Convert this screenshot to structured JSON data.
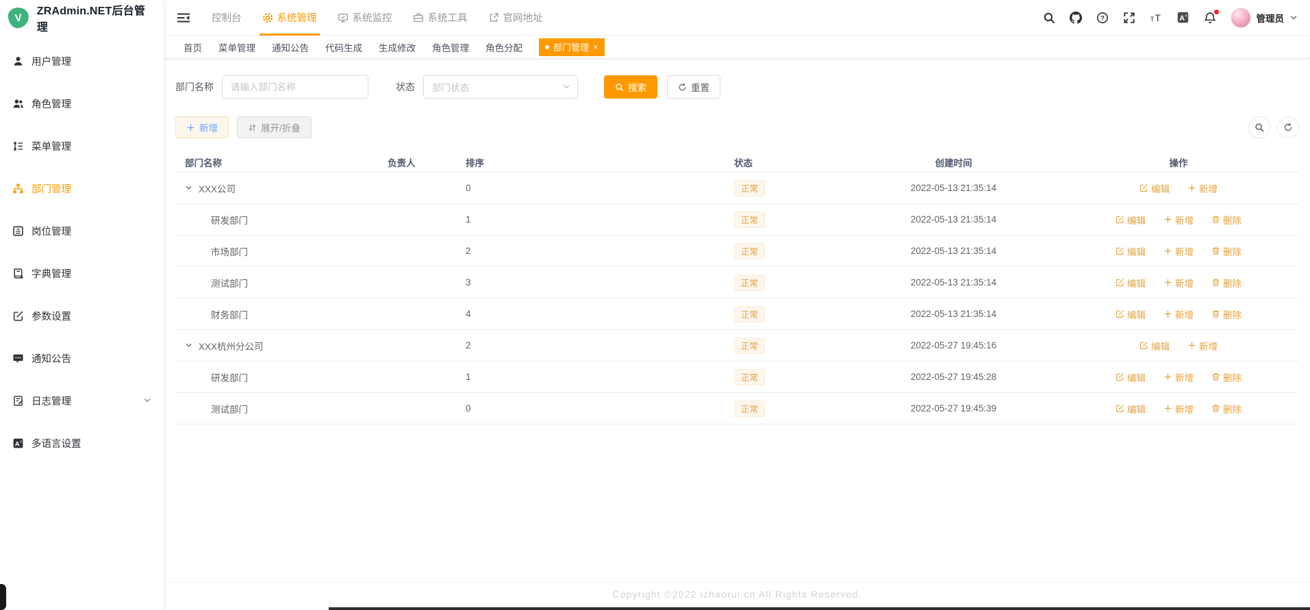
{
  "app": {
    "title": "ZRAdmin.NET后台管理",
    "logo_letter": "V"
  },
  "sidebar": {
    "items": [
      {
        "name": "user-management",
        "icon": "user",
        "label": "用户管理"
      },
      {
        "name": "role-management",
        "icon": "users",
        "label": "角色管理"
      },
      {
        "name": "menu-management",
        "icon": "menu",
        "label": "菜单管理"
      },
      {
        "name": "dept-management",
        "icon": "dept",
        "label": "部门管理",
        "active": true
      },
      {
        "name": "post-management",
        "icon": "post",
        "label": "岗位管理"
      },
      {
        "name": "dict-management",
        "icon": "dict",
        "label": "字典管理"
      },
      {
        "name": "param-settings",
        "icon": "param",
        "label": "参数设置"
      },
      {
        "name": "notice",
        "icon": "notice",
        "label": "通知公告"
      },
      {
        "name": "log-management",
        "icon": "log",
        "label": "日志管理",
        "has_children": true
      },
      {
        "name": "i18n-settings",
        "icon": "lang",
        "label": "多语言设置"
      }
    ]
  },
  "topnav": {
    "items": [
      {
        "name": "console",
        "label": "控制台"
      },
      {
        "name": "system-management",
        "label": "系统管理",
        "icon": "gear",
        "active": true
      },
      {
        "name": "system-monitor",
        "label": "系统监控",
        "icon": "monitor"
      },
      {
        "name": "system-tools",
        "label": "系统工具",
        "icon": "tools"
      },
      {
        "name": "official-site",
        "label": "官网地址",
        "icon": "extlink"
      }
    ]
  },
  "header": {
    "user_label": "管理员",
    "notification_badge": true
  },
  "tags_view": {
    "tabs": [
      {
        "name": "home",
        "label": "首页"
      },
      {
        "name": "menu-management",
        "label": "菜单管理"
      },
      {
        "name": "notice",
        "label": "通知公告"
      },
      {
        "name": "code-generation",
        "label": "代码生成"
      },
      {
        "name": "generation-edit",
        "label": "生成修改"
      },
      {
        "name": "role-management",
        "label": "角色管理"
      },
      {
        "name": "role-assign",
        "label": "角色分配"
      },
      {
        "name": "dept-management",
        "label": "部门管理",
        "active": true,
        "closable": true
      }
    ]
  },
  "filter": {
    "name_label": "部门名称",
    "name_placeholder": "请输入部门名称",
    "status_label": "状态",
    "status_placeholder": "部门状态",
    "search_label": "搜索",
    "reset_label": "重置"
  },
  "toolbar": {
    "add_label": "新增",
    "expand_label": "展开/折叠"
  },
  "table": {
    "columns": [
      {
        "label": "部门名称"
      },
      {
        "label": "负责人"
      },
      {
        "label": "排序"
      },
      {
        "label": "状态"
      },
      {
        "label": "创建时间"
      },
      {
        "label": "操作"
      }
    ],
    "action_labels": {
      "edit": "编辑",
      "add": "新增",
      "delete": "删除"
    },
    "rows": [
      {
        "name": "XXX公司",
        "level": 0,
        "expanded": true,
        "manager": "",
        "sort": "0",
        "status": "正常",
        "created": "2022-05-13 21:35:14",
        "deletable": false
      },
      {
        "name": "研发部门",
        "level": 1,
        "expanded": false,
        "manager": "",
        "sort": "1",
        "status": "正常",
        "created": "2022-05-13 21:35:14",
        "deletable": true
      },
      {
        "name": "市场部门",
        "level": 1,
        "expanded": false,
        "manager": "",
        "sort": "2",
        "status": "正常",
        "created": "2022-05-13 21:35:14",
        "deletable": true
      },
      {
        "name": "测试部门",
        "level": 1,
        "expanded": false,
        "manager": "",
        "sort": "3",
        "status": "正常",
        "created": "2022-05-13 21:35:14",
        "deletable": true
      },
      {
        "name": "财务部门",
        "level": 1,
        "expanded": false,
        "manager": "",
        "sort": "4",
        "status": "正常",
        "created": "2022-05-13 21:35:14",
        "deletable": true
      },
      {
        "name": "XXX杭州分公司",
        "level": 0,
        "expanded": true,
        "manager": "",
        "sort": "2",
        "status": "正常",
        "created": "2022-05-27 19:45:16",
        "deletable": false
      },
      {
        "name": "研发部门",
        "level": 1,
        "expanded": false,
        "manager": "",
        "sort": "1",
        "status": "正常",
        "created": "2022-05-27 19:45:28",
        "deletable": true
      },
      {
        "name": "测试部门",
        "level": 1,
        "expanded": false,
        "manager": "",
        "sort": "0",
        "status": "正常",
        "created": "2022-05-27 19:45:39",
        "deletable": true
      }
    ]
  },
  "footer": {
    "copyright": "Copyright ©2022 izhaorui.cn All Rights Reserved."
  },
  "colors": {
    "accent": "#ff9900",
    "tag_text": "#e6a23c",
    "tag_bg": "#fdf6ec",
    "tag_border": "#faecd8",
    "add_button_text": "#6ba1f8",
    "action_link": "#e6a23c",
    "logo_green": "#3eb27f",
    "notification_dot": "#f5222d"
  },
  "icons": {
    "logo": "green-blob-v",
    "hamburger": "menu-fold-icon",
    "header_right": [
      "search-icon",
      "github-icon",
      "help-icon",
      "fullscreen-icon",
      "font-size-icon",
      "translate-icon",
      "bell-icon"
    ],
    "toolbar_right": [
      "search-toggle-icon",
      "refresh-icon"
    ]
  }
}
